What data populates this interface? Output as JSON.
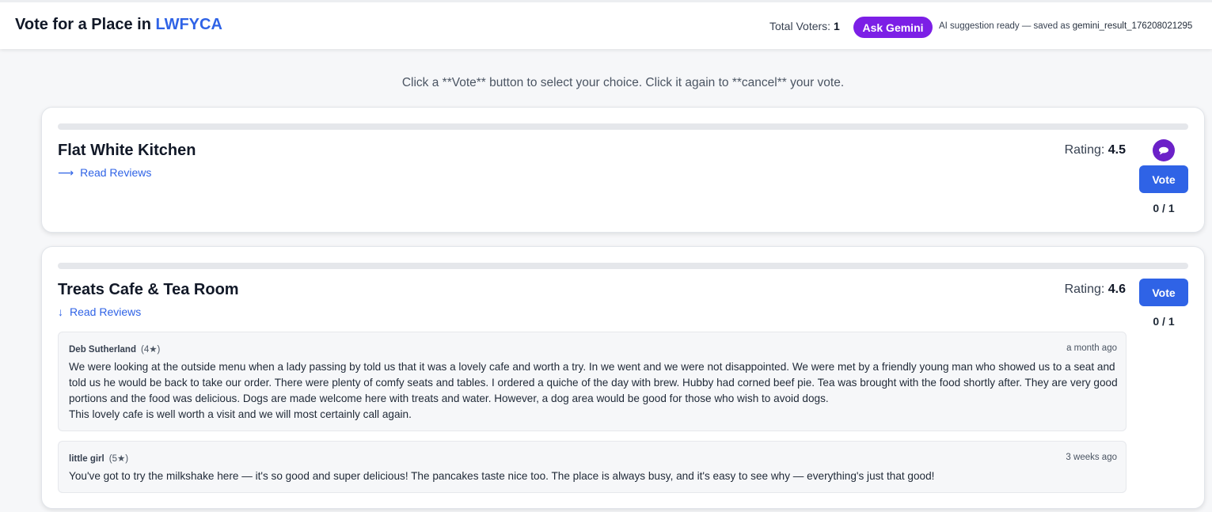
{
  "header": {
    "title_prefix": "Vote for a Place in ",
    "room_code": "LWFYCA",
    "voters_label": "Total Voters: ",
    "voters_count": "1",
    "ask_button": "Ask Gemini",
    "ai_status": "AI suggestion ready — saved as ",
    "ai_file": "gemini_result_176208021295"
  },
  "instructions": "Click a **Vote** button to select your choice. Click it again to **cancel** your vote.",
  "places": [
    {
      "name": "Flat White Kitchen",
      "reviews_link": "Read Reviews",
      "reviews_arrow": "⟶",
      "rating_label": "Rating: ",
      "rating": "4.5",
      "vote_label": "Vote",
      "vote_count": "0 / 1",
      "has_ai_icon": true
    },
    {
      "name": "Treats Cafe & Tea Room",
      "reviews_link": "Read Reviews",
      "reviews_arrow": "↓",
      "rating_label": "Rating: ",
      "rating": "4.6",
      "vote_label": "Vote",
      "vote_count": "0 / 1",
      "reviews": [
        {
          "author": "Deb Sutherland",
          "stars": "(4★)",
          "when": "a month ago",
          "text": "We were looking at the outside menu when a lady passing by told us that it was a lovely cafe and worth a try. In we went and we were not disappointed. We were met by a friendly young man who showed us to a seat and told us he would be back to take our order. There were plenty of comfy seats and tables. I ordered a quiche of the day with brew. Hubby had corned beef pie. Tea was brought with the food shortly after. They are very good portions and the food was delicious. Dogs are made welcome here with treats and water. However, a dog area would be good for those who wish to avoid dogs.\nThis lovely cafe is well worth a visit and we will most certainly call again."
        },
        {
          "author": "little girl",
          "stars": "(5★)",
          "when": "3 weeks ago",
          "text": "You've got to try the milkshake here — it's so good and super delicious! The pancakes taste nice too. The place is always busy, and it's easy to see why — everything's just that good!"
        }
      ]
    }
  ],
  "colors": {
    "accent_blue": "#2f63e6",
    "gemini_purple": "#7c1fe6",
    "ai_icon_purple": "#6b21c8"
  }
}
